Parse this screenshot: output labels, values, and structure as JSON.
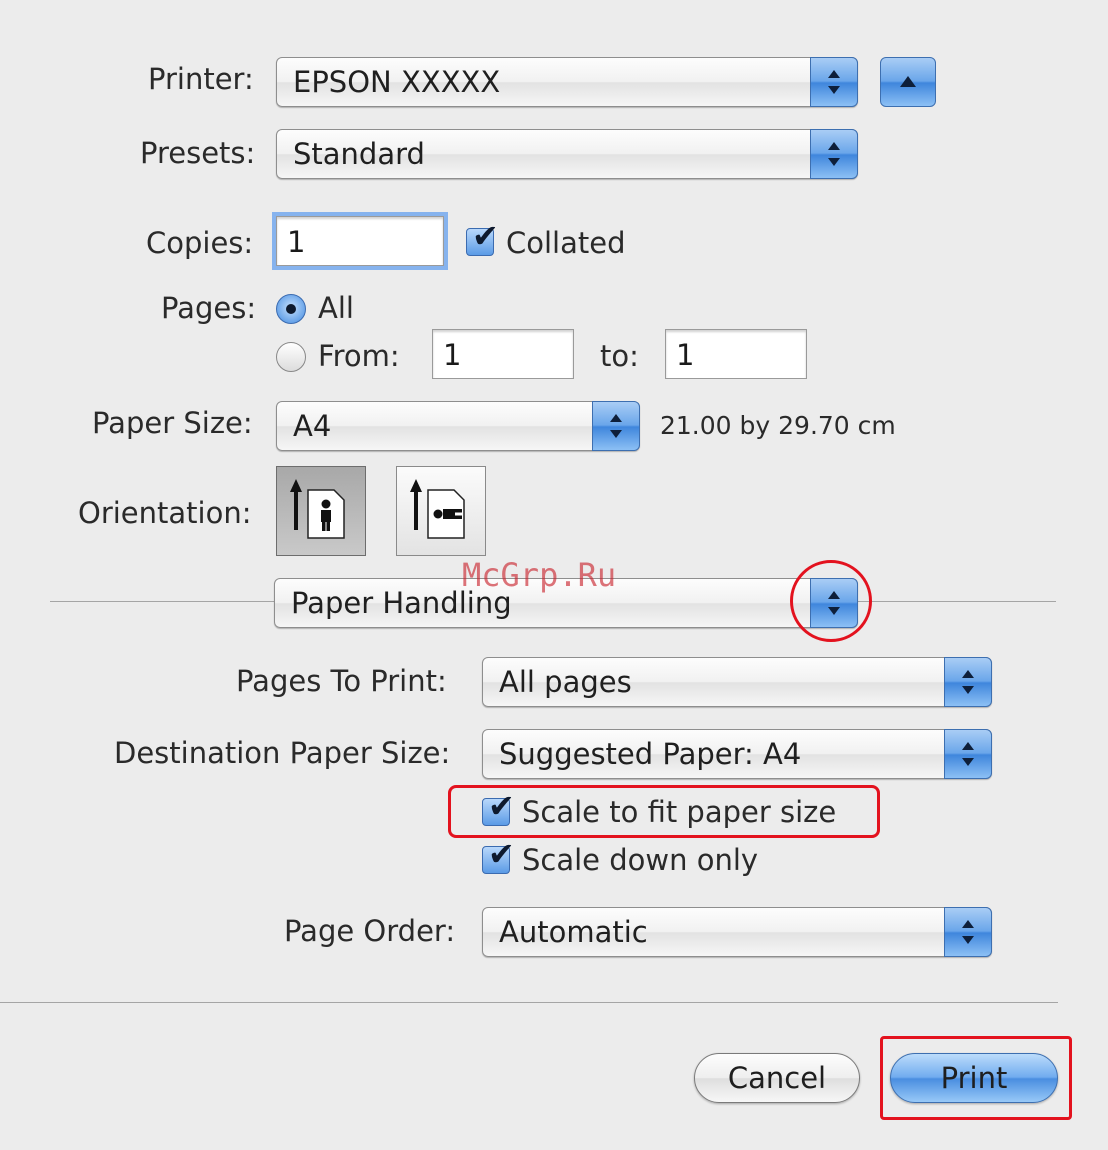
{
  "printer": {
    "label": "Printer:",
    "value": "EPSON XXXXX"
  },
  "presets": {
    "label": "Presets:",
    "value": "Standard"
  },
  "copies": {
    "label": "Copies:",
    "value": "1",
    "collated_label": "Collated",
    "collated_checked": true
  },
  "pages": {
    "label": "Pages:",
    "all_label": "All",
    "from_label": "From:",
    "from_value": "1",
    "to_label": "to:",
    "to_value": "1",
    "selected": "All"
  },
  "paper_size": {
    "label": "Paper Size:",
    "value": "A4",
    "dimensions": "21.00 by 29.70 cm"
  },
  "orientation": {
    "label": "Orientation:",
    "options": [
      "portrait",
      "landscape"
    ],
    "selected": "portrait"
  },
  "section_menu": {
    "value": "Paper Handling"
  },
  "paper_handling": {
    "pages_to_print": {
      "label": "Pages To Print:",
      "value": "All pages"
    },
    "destination_paper_size": {
      "label": "Destination Paper Size:",
      "value": "Suggested Paper: A4"
    },
    "scale_to_fit": {
      "label": "Scale to fit paper size",
      "checked": true
    },
    "scale_down_only": {
      "label": "Scale down only",
      "checked": true
    },
    "page_order": {
      "label": "Page Order:",
      "value": "Automatic"
    }
  },
  "buttons": {
    "cancel": "Cancel",
    "print": "Print"
  },
  "watermark": "McGrp.Ru",
  "colors": {
    "accent": "#5b9be6",
    "annotation": "#e3121e"
  },
  "icons": {
    "disclosure": "disclosure-triangle-icon",
    "popup": "updown-arrows-icon",
    "check": "checkmark-icon"
  }
}
